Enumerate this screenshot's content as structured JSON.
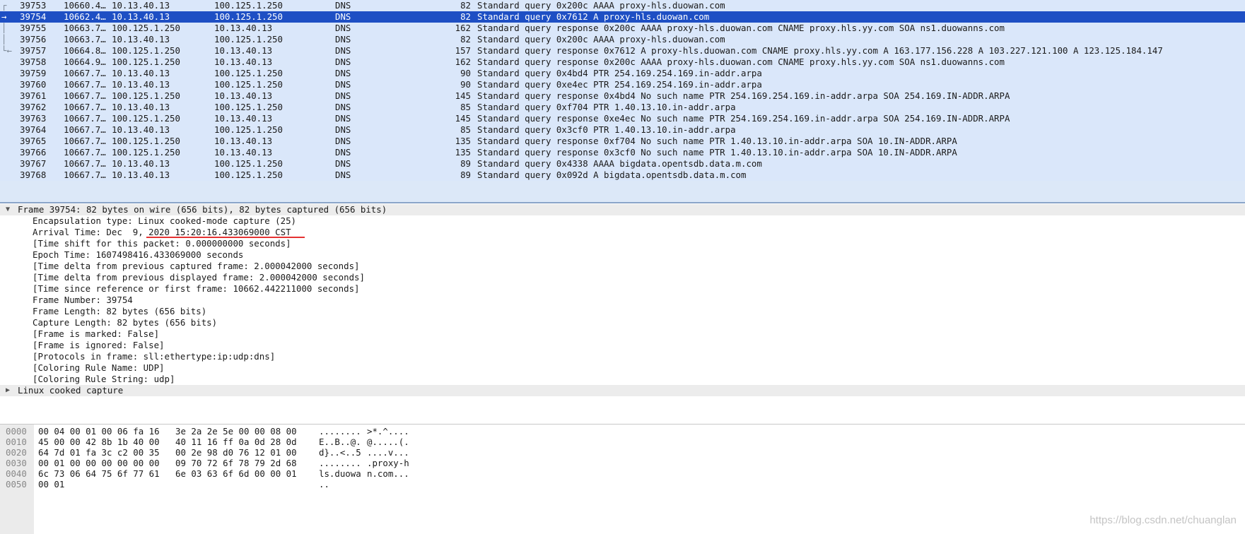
{
  "packet_list": {
    "rows": [
      {
        "no": "39753",
        "time": "10660.4…",
        "src": "10.13.40.13",
        "dst": "100.125.1.250",
        "proto": "DNS",
        "len": "82",
        "info": "Standard query 0x200c AAAA proxy-hls.duowan.com",
        "rel": "┌",
        "selected": false
      },
      {
        "no": "39754",
        "time": "10662.4…",
        "src": "10.13.40.13",
        "dst": "100.125.1.250",
        "proto": "DNS",
        "len": "82",
        "info": "Standard query 0x7612 A proxy-hls.duowan.com",
        "rel": "→",
        "selected": true
      },
      {
        "no": "39755",
        "time": "10663.7…",
        "src": "100.125.1.250",
        "dst": "10.13.40.13",
        "proto": "DNS",
        "len": "162",
        "info": "Standard query response 0x200c AAAA proxy-hls.duowan.com CNAME proxy.hls.yy.com SOA ns1.duowanns.com",
        "rel": "│",
        "selected": false
      },
      {
        "no": "39756",
        "time": "10663.7…",
        "src": "10.13.40.13",
        "dst": "100.125.1.250",
        "proto": "DNS",
        "len": "82",
        "info": "Standard query 0x200c AAAA proxy-hls.duowan.com",
        "rel": "│",
        "selected": false
      },
      {
        "no": "39757",
        "time": "10664.8…",
        "src": "100.125.1.250",
        "dst": "10.13.40.13",
        "proto": "DNS",
        "len": "157",
        "info": "Standard query response 0x7612 A proxy-hls.duowan.com CNAME proxy.hls.yy.com A 163.177.156.228 A 103.227.121.100 A 123.125.184.147",
        "rel": "└←",
        "selected": false
      },
      {
        "no": "39758",
        "time": "10664.9…",
        "src": "100.125.1.250",
        "dst": "10.13.40.13",
        "proto": "DNS",
        "len": "162",
        "info": "Standard query response 0x200c AAAA proxy-hls.duowan.com CNAME proxy.hls.yy.com SOA ns1.duowanns.com",
        "rel": "",
        "selected": false
      },
      {
        "no": "39759",
        "time": "10667.7…",
        "src": "10.13.40.13",
        "dst": "100.125.1.250",
        "proto": "DNS",
        "len": "90",
        "info": "Standard query 0x4bd4 PTR 254.169.254.169.in-addr.arpa",
        "rel": "",
        "selected": false
      },
      {
        "no": "39760",
        "time": "10667.7…",
        "src": "10.13.40.13",
        "dst": "100.125.1.250",
        "proto": "DNS",
        "len": "90",
        "info": "Standard query 0xe4ec PTR 254.169.254.169.in-addr.arpa",
        "rel": "",
        "selected": false
      },
      {
        "no": "39761",
        "time": "10667.7…",
        "src": "100.125.1.250",
        "dst": "10.13.40.13",
        "proto": "DNS",
        "len": "145",
        "info": "Standard query response 0x4bd4 No such name PTR 254.169.254.169.in-addr.arpa SOA 254.169.IN-ADDR.ARPA",
        "rel": "",
        "selected": false
      },
      {
        "no": "39762",
        "time": "10667.7…",
        "src": "10.13.40.13",
        "dst": "100.125.1.250",
        "proto": "DNS",
        "len": "85",
        "info": "Standard query 0xf704 PTR 1.40.13.10.in-addr.arpa",
        "rel": "",
        "selected": false
      },
      {
        "no": "39763",
        "time": "10667.7…",
        "src": "100.125.1.250",
        "dst": "10.13.40.13",
        "proto": "DNS",
        "len": "145",
        "info": "Standard query response 0xe4ec No such name PTR 254.169.254.169.in-addr.arpa SOA 254.169.IN-ADDR.ARPA",
        "rel": "",
        "selected": false
      },
      {
        "no": "39764",
        "time": "10667.7…",
        "src": "10.13.40.13",
        "dst": "100.125.1.250",
        "proto": "DNS",
        "len": "85",
        "info": "Standard query 0x3cf0 PTR 1.40.13.10.in-addr.arpa",
        "rel": "",
        "selected": false
      },
      {
        "no": "39765",
        "time": "10667.7…",
        "src": "100.125.1.250",
        "dst": "10.13.40.13",
        "proto": "DNS",
        "len": "135",
        "info": "Standard query response 0xf704 No such name PTR 1.40.13.10.in-addr.arpa SOA 10.IN-ADDR.ARPA",
        "rel": "",
        "selected": false
      },
      {
        "no": "39766",
        "time": "10667.7…",
        "src": "100.125.1.250",
        "dst": "10.13.40.13",
        "proto": "DNS",
        "len": "135",
        "info": "Standard query response 0x3cf0 No such name PTR 1.40.13.10.in-addr.arpa SOA 10.IN-ADDR.ARPA",
        "rel": "",
        "selected": false
      },
      {
        "no": "39767",
        "time": "10667.7…",
        "src": "10.13.40.13",
        "dst": "100.125.1.250",
        "proto": "DNS",
        "len": "89",
        "info": "Standard query 0x4338 AAAA bigdata.opentsdb.data.m.com",
        "rel": "",
        "selected": false
      },
      {
        "no": "39768",
        "time": "10667.7…",
        "src": "10.13.40.13",
        "dst": "100.125.1.250",
        "proto": "DNS",
        "len": "89",
        "info": "Standard query 0x092d A bigdata.opentsdb.data.m.com",
        "rel": "",
        "selected": false
      }
    ]
  },
  "details": {
    "frame_header": "Frame 39754: 82 bytes on wire (656 bits), 82 bytes captured (656 bits)",
    "frame_fields": [
      "Encapsulation type: Linux cooked-mode capture (25)",
      "Arrival Time: Dec  9, 2020 15:20:16.433069000 CST",
      "[Time shift for this packet: 0.000000000 seconds]",
      "Epoch Time: 1607498416.433069000 seconds",
      "[Time delta from previous captured frame: 2.000042000 seconds]",
      "[Time delta from previous displayed frame: 2.000042000 seconds]",
      "[Time since reference or first frame: 10662.442211000 seconds]",
      "Frame Number: 39754",
      "Frame Length: 82 bytes (656 bits)",
      "Capture Length: 82 bytes (656 bits)",
      "[Frame is marked: False]",
      "[Frame is ignored: False]",
      "[Protocols in frame: sll:ethertype:ip:udp:dns]",
      "[Coloring Rule Name: UDP]",
      "[Coloring Rule String: udp]"
    ],
    "linux_cooked_header": "Linux cooked capture",
    "expanded_arrow": "▼",
    "collapsed_arrow": "▶"
  },
  "bytes": {
    "rows": [
      {
        "off": "0000",
        "hex1": "00 04 00 01 00 06 fa 16",
        "hex2": "3e 2a 2e 5e 00 00 08 00",
        "asc1": "........",
        "asc2": ">*.^...."
      },
      {
        "off": "0010",
        "hex1": "45 00 00 42 8b 1b 40 00",
        "hex2": "40 11 16 ff 0a 0d 28 0d",
        "asc1": "E..B..@.",
        "asc2": "@.....(."
      },
      {
        "off": "0020",
        "hex1": "64 7d 01 fa 3c c2 00 35",
        "hex2": "00 2e 98 d0 76 12 01 00",
        "asc1": "d}..<..5",
        "asc2": "....v..."
      },
      {
        "off": "0030",
        "hex1": "00 01 00 00 00 00 00 00",
        "hex2": "09 70 72 6f 78 79 2d 68",
        "asc1": "........",
        "asc2": ".proxy-h"
      },
      {
        "off": "0040",
        "hex1": "6c 73 06 64 75 6f 77 61",
        "hex2": "6e 03 63 6f 6d 00 00 01",
        "asc1": "ls.duowa",
        "asc2": "n.com..."
      },
      {
        "off": "0050",
        "hex1": "00 01",
        "hex2": "",
        "asc1": "..",
        "asc2": ""
      }
    ]
  },
  "watermark": "https://blog.csdn.net/chuanglan",
  "colors": {
    "selected_row": "#1e4fc4",
    "row_bg": "#dae7fa",
    "annotation_underline": "#e53232"
  }
}
